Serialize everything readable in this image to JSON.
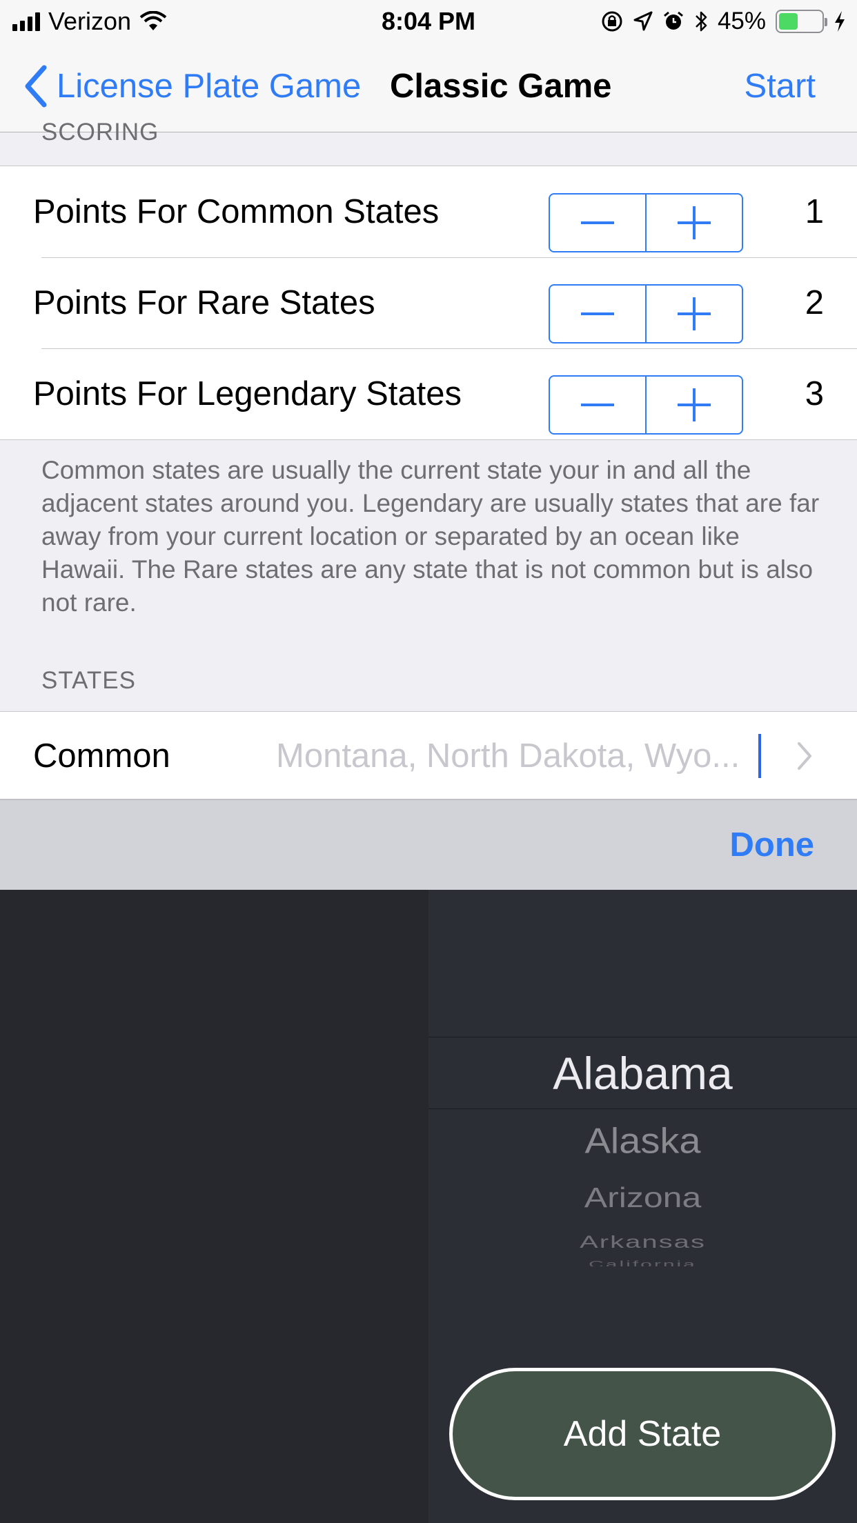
{
  "status_bar": {
    "carrier": "Verizon",
    "time": "8:04 PM",
    "battery_percent": "45%",
    "battery_level": 0.45,
    "icons": [
      "signal-icon",
      "wifi-icon",
      "orientation-lock-icon",
      "location-icon",
      "alarm-icon",
      "bluetooth-icon",
      "battery-icon",
      "charging-icon"
    ]
  },
  "nav": {
    "back_label": "License Plate Game",
    "title": "Classic Game",
    "right_label": "Start"
  },
  "scoring": {
    "header": "SCORING",
    "rows": [
      {
        "label": "Points For Common States",
        "value": "1"
      },
      {
        "label": "Points For Rare States",
        "value": "2"
      },
      {
        "label": "Points For Legendary States",
        "value": "3"
      }
    ],
    "footer": "Common states are usually the current state your in and all the adjacent states around you. Legendary are usually states that are far away from your current location or separated by an ocean like Hawaii. The Rare states are any state that is not common but is also not rare."
  },
  "states": {
    "header": "STATES",
    "row_label": "Common",
    "field_value": "Montana, North Dakota, Wyo..."
  },
  "toolbar": {
    "done_label": "Done"
  },
  "picker": {
    "items": [
      "Alabama",
      "Alaska",
      "Arizona",
      "Arkansas",
      "California"
    ],
    "selected": "Alabama"
  },
  "add_button_label": "Add State",
  "colors": {
    "accent": "#2f7cf6",
    "picker_background": "#2c2e35",
    "add_button_fill": "#445449",
    "battery_fill": "#4cd964"
  }
}
